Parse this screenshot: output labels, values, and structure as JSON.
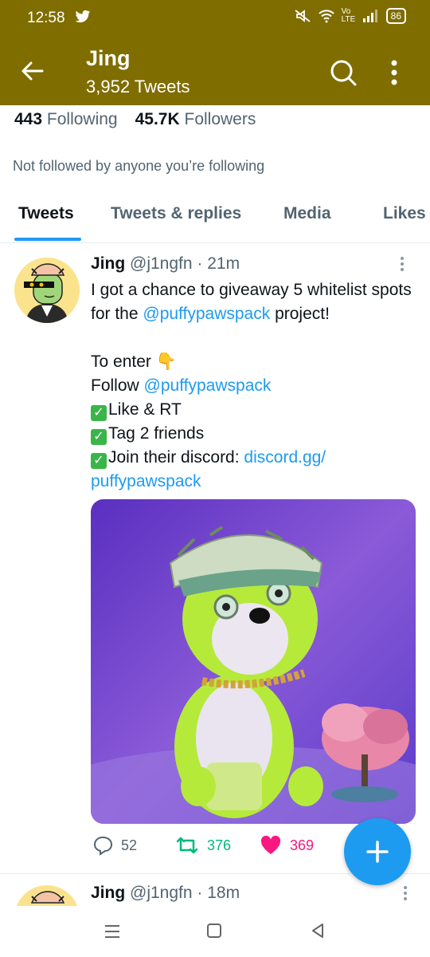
{
  "status": {
    "time": "12:58",
    "battery": "86",
    "net": "Vo LTE"
  },
  "header": {
    "name": "Jing",
    "tweet_count": "3,952 Tweets"
  },
  "profile": {
    "following_count": "443",
    "following_label": "Following",
    "followers_count": "45.7K",
    "followers_label": "Followers",
    "not_followed": "Not followed by anyone you’re following"
  },
  "tabs": [
    "Tweets",
    "Tweets & replies",
    "Media",
    "Likes"
  ],
  "tweet": {
    "name": "Jing",
    "handle": "@j1ngfn",
    "time": "· 21m",
    "line1": "I got a chance to giveaway 5 whitelist spots for the ",
    "mention1": "@puffypawspack",
    "line1_end": " project!",
    "to_enter": "To enter 👇",
    "follow_prefix": "Follow ",
    "mention2": "@puffypawspack",
    "item1": "Like & RT",
    "item2": "Tag 2 friends",
    "item3": "Join their discord: ",
    "discord_link": "discord.gg/",
    "discord_link2": "puffypawspack",
    "replies": "52",
    "retweets": "376",
    "likes": "369"
  },
  "tweet2": {
    "name": "Jing",
    "handle": "@j1ngfn",
    "time": "· 18m"
  },
  "colors": {
    "header": "#7f6d00",
    "accent": "#1d9bf0",
    "retweet": "#00ba7c",
    "like": "#f91880"
  }
}
